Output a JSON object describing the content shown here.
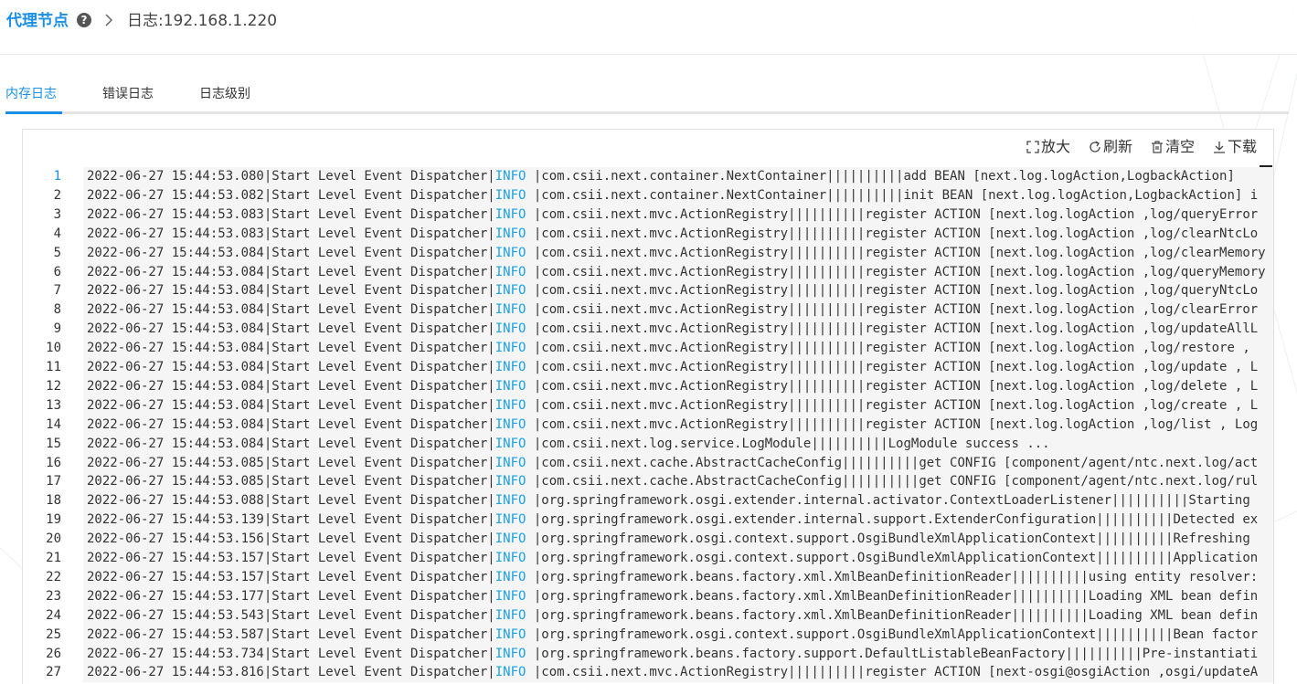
{
  "breadcrumb": {
    "root": "代理节点",
    "current": "日志:192.168.1.220",
    "help_icon": "question-circle-icon",
    "separator_icon": "chevron-right-icon"
  },
  "tabs": [
    {
      "label": "内存日志",
      "active": true
    },
    {
      "label": "错误日志",
      "active": false
    },
    {
      "label": "日志级别",
      "active": false
    }
  ],
  "toolbar": {
    "zoom": {
      "label": "放大",
      "icon": "expand-icon"
    },
    "refresh": {
      "label": "刷新",
      "icon": "refresh-icon"
    },
    "clear": {
      "label": "清空",
      "icon": "trash-icon"
    },
    "download": {
      "label": "下载",
      "icon": "download-icon"
    }
  },
  "colors": {
    "accent": "#1a8fe6",
    "level": "#1aa0e6"
  },
  "log": {
    "active_line": 1,
    "lines": [
      {
        "n": "1",
        "a": "2022-06-27 15:44:53.080|Start Level Event Dispatcher|",
        "l": "INFO",
        "b": " |com.csii.next.container.NextContainer||||||||||add BEAN [next.log.logAction,LogbackAction]"
      },
      {
        "n": "2",
        "a": "2022-06-27 15:44:53.082|Start Level Event Dispatcher|",
        "l": "INFO",
        "b": " |com.csii.next.container.NextContainer||||||||||init BEAN [next.log.logAction,LogbackAction] i"
      },
      {
        "n": "3",
        "a": "2022-06-27 15:44:53.083|Start Level Event Dispatcher|",
        "l": "INFO",
        "b": " |com.csii.next.mvc.ActionRegistry||||||||||register ACTION [next.log.logAction ,log/queryError"
      },
      {
        "n": "4",
        "a": "2022-06-27 15:44:53.083|Start Level Event Dispatcher|",
        "l": "INFO",
        "b": " |com.csii.next.mvc.ActionRegistry||||||||||register ACTION [next.log.logAction ,log/clearNtcLo"
      },
      {
        "n": "5",
        "a": "2022-06-27 15:44:53.084|Start Level Event Dispatcher|",
        "l": "INFO",
        "b": " |com.csii.next.mvc.ActionRegistry||||||||||register ACTION [next.log.logAction ,log/clearMemory"
      },
      {
        "n": "6",
        "a": "2022-06-27 15:44:53.084|Start Level Event Dispatcher|",
        "l": "INFO",
        "b": " |com.csii.next.mvc.ActionRegistry||||||||||register ACTION [next.log.logAction ,log/queryMemory"
      },
      {
        "n": "7",
        "a": "2022-06-27 15:44:53.084|Start Level Event Dispatcher|",
        "l": "INFO",
        "b": " |com.csii.next.mvc.ActionRegistry||||||||||register ACTION [next.log.logAction ,log/queryNtcLo"
      },
      {
        "n": "8",
        "a": "2022-06-27 15:44:53.084|Start Level Event Dispatcher|",
        "l": "INFO",
        "b": " |com.csii.next.mvc.ActionRegistry||||||||||register ACTION [next.log.logAction ,log/clearError"
      },
      {
        "n": "9",
        "a": "2022-06-27 15:44:53.084|Start Level Event Dispatcher|",
        "l": "INFO",
        "b": " |com.csii.next.mvc.ActionRegistry||||||||||register ACTION [next.log.logAction ,log/updateAllL"
      },
      {
        "n": "10",
        "a": "2022-06-27 15:44:53.084|Start Level Event Dispatcher|",
        "l": "INFO",
        "b": " |com.csii.next.mvc.ActionRegistry||||||||||register ACTION [next.log.logAction ,log/restore , "
      },
      {
        "n": "11",
        "a": "2022-06-27 15:44:53.084|Start Level Event Dispatcher|",
        "l": "INFO",
        "b": " |com.csii.next.mvc.ActionRegistry||||||||||register ACTION [next.log.logAction ,log/update , L"
      },
      {
        "n": "12",
        "a": "2022-06-27 15:44:53.084|Start Level Event Dispatcher|",
        "l": "INFO",
        "b": " |com.csii.next.mvc.ActionRegistry||||||||||register ACTION [next.log.logAction ,log/delete , L"
      },
      {
        "n": "13",
        "a": "2022-06-27 15:44:53.084|Start Level Event Dispatcher|",
        "l": "INFO",
        "b": " |com.csii.next.mvc.ActionRegistry||||||||||register ACTION [next.log.logAction ,log/create , L"
      },
      {
        "n": "14",
        "a": "2022-06-27 15:44:53.084|Start Level Event Dispatcher|",
        "l": "INFO",
        "b": " |com.csii.next.mvc.ActionRegistry||||||||||register ACTION [next.log.logAction ,log/list , Log"
      },
      {
        "n": "15",
        "a": "2022-06-27 15:44:53.084|Start Level Event Dispatcher|",
        "l": "INFO",
        "b": " |com.csii.next.log.service.LogModule||||||||||LogModule success ..."
      },
      {
        "n": "16",
        "a": "2022-06-27 15:44:53.085|Start Level Event Dispatcher|",
        "l": "INFO",
        "b": " |com.csii.next.cache.AbstractCacheConfig||||||||||get CONFIG [component/agent/ntc.next.log/act"
      },
      {
        "n": "17",
        "a": "2022-06-27 15:44:53.085|Start Level Event Dispatcher|",
        "l": "INFO",
        "b": " |com.csii.next.cache.AbstractCacheConfig||||||||||get CONFIG [component/agent/ntc.next.log/rul"
      },
      {
        "n": "18",
        "a": "2022-06-27 15:44:53.088|Start Level Event Dispatcher|",
        "l": "INFO",
        "b": " |org.springframework.osgi.extender.internal.activator.ContextLoaderListener||||||||||Starting "
      },
      {
        "n": "19",
        "a": "2022-06-27 15:44:53.139|Start Level Event Dispatcher|",
        "l": "INFO",
        "b": " |org.springframework.osgi.extender.internal.support.ExtenderConfiguration||||||||||Detected ex"
      },
      {
        "n": "20",
        "a": "2022-06-27 15:44:53.156|Start Level Event Dispatcher|",
        "l": "INFO",
        "b": " |org.springframework.osgi.context.support.OsgiBundleXmlApplicationContext||||||||||Refreshing "
      },
      {
        "n": "21",
        "a": "2022-06-27 15:44:53.157|Start Level Event Dispatcher|",
        "l": "INFO",
        "b": " |org.springframework.osgi.context.support.OsgiBundleXmlApplicationContext||||||||||Application"
      },
      {
        "n": "22",
        "a": "2022-06-27 15:44:53.157|Start Level Event Dispatcher|",
        "l": "INFO",
        "b": " |org.springframework.beans.factory.xml.XmlBeanDefinitionReader||||||||||using entity resolver:"
      },
      {
        "n": "23",
        "a": "2022-06-27 15:44:53.177|Start Level Event Dispatcher|",
        "l": "INFO",
        "b": " |org.springframework.beans.factory.xml.XmlBeanDefinitionReader||||||||||Loading XML bean defin"
      },
      {
        "n": "24",
        "a": "2022-06-27 15:44:53.543|Start Level Event Dispatcher|",
        "l": "INFO",
        "b": " |org.springframework.beans.factory.xml.XmlBeanDefinitionReader||||||||||Loading XML bean defin"
      },
      {
        "n": "25",
        "a": "2022-06-27 15:44:53.587|Start Level Event Dispatcher|",
        "l": "INFO",
        "b": " |org.springframework.osgi.context.support.OsgiBundleXmlApplicationContext||||||||||Bean factor"
      },
      {
        "n": "26",
        "a": "2022-06-27 15:44:53.734|Start Level Event Dispatcher|",
        "l": "INFO",
        "b": " |org.springframework.beans.factory.support.DefaultListableBeanFactory||||||||||Pre-instantiati"
      },
      {
        "n": "27",
        "a": "2022-06-27 15:44:53.816|Start Level Event Dispatcher|",
        "l": "INFO",
        "b": " |com.csii.next.mvc.ActionRegistry||||||||||register ACTION [next-osgi@osgiAction ,osgi/updateA"
      }
    ]
  }
}
